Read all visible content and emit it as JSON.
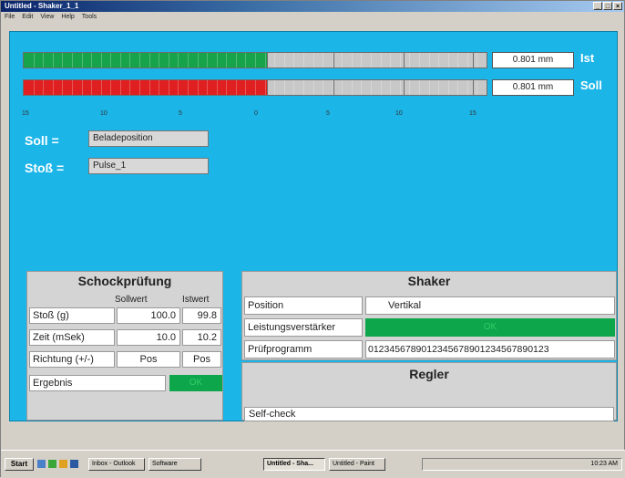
{
  "window": {
    "title": "Untitled - Shaker_1_1",
    "controls": [
      "_",
      "□",
      "×"
    ]
  },
  "menu": [
    "File",
    "Edit",
    "View",
    "Help",
    "Tools"
  ],
  "bars": {
    "ist": {
      "label": "Ist",
      "value": "0.801 mm",
      "color": "#16a34a",
      "fill": 0.525
    },
    "soll": {
      "label": "Soll",
      "value": "0.801 mm",
      "color": "#e02020",
      "fill": 0.525
    }
  },
  "scale": [
    "15",
    "10",
    "5",
    "0",
    "5",
    "10",
    "15"
  ],
  "soll": {
    "label": "Soll =",
    "value": "Beladeposition"
  },
  "stoss": {
    "label": "Stoß =",
    "value": "Pulse_1"
  },
  "schock": {
    "title": "Schockprüfung",
    "col_soll": "Sollwert",
    "col_ist": "Istwert",
    "rows": [
      {
        "label": "Stoß (g)",
        "soll": "100.0",
        "ist": "99.8"
      },
      {
        "label": "Zeit (mSek)",
        "soll": "10.0",
        "ist": "10.2"
      },
      {
        "label": "Richtung (+/-)",
        "soll": "Pos",
        "ist": "Pos"
      }
    ],
    "ergebnis_label": "Ergebnis",
    "ergebnis_value": "OK"
  },
  "shaker": {
    "title": "Shaker",
    "position_label": "Position",
    "position_value": "Vertikal",
    "verstaerker_label": "Leistungsverstärker",
    "verstaerker_value": "OK",
    "programm_label": "Prüfprogramm",
    "programm_value": "0123456789012345678901234567890123"
  },
  "regler": {
    "title": "Regler",
    "status": "Self-check"
  },
  "taskbar": {
    "start": "Start",
    "tasks": [
      "Inbox - Outlook",
      "Software",
      "Untitled - Sha...",
      "Untitled - Paint"
    ],
    "clock": "10:23 AM"
  }
}
